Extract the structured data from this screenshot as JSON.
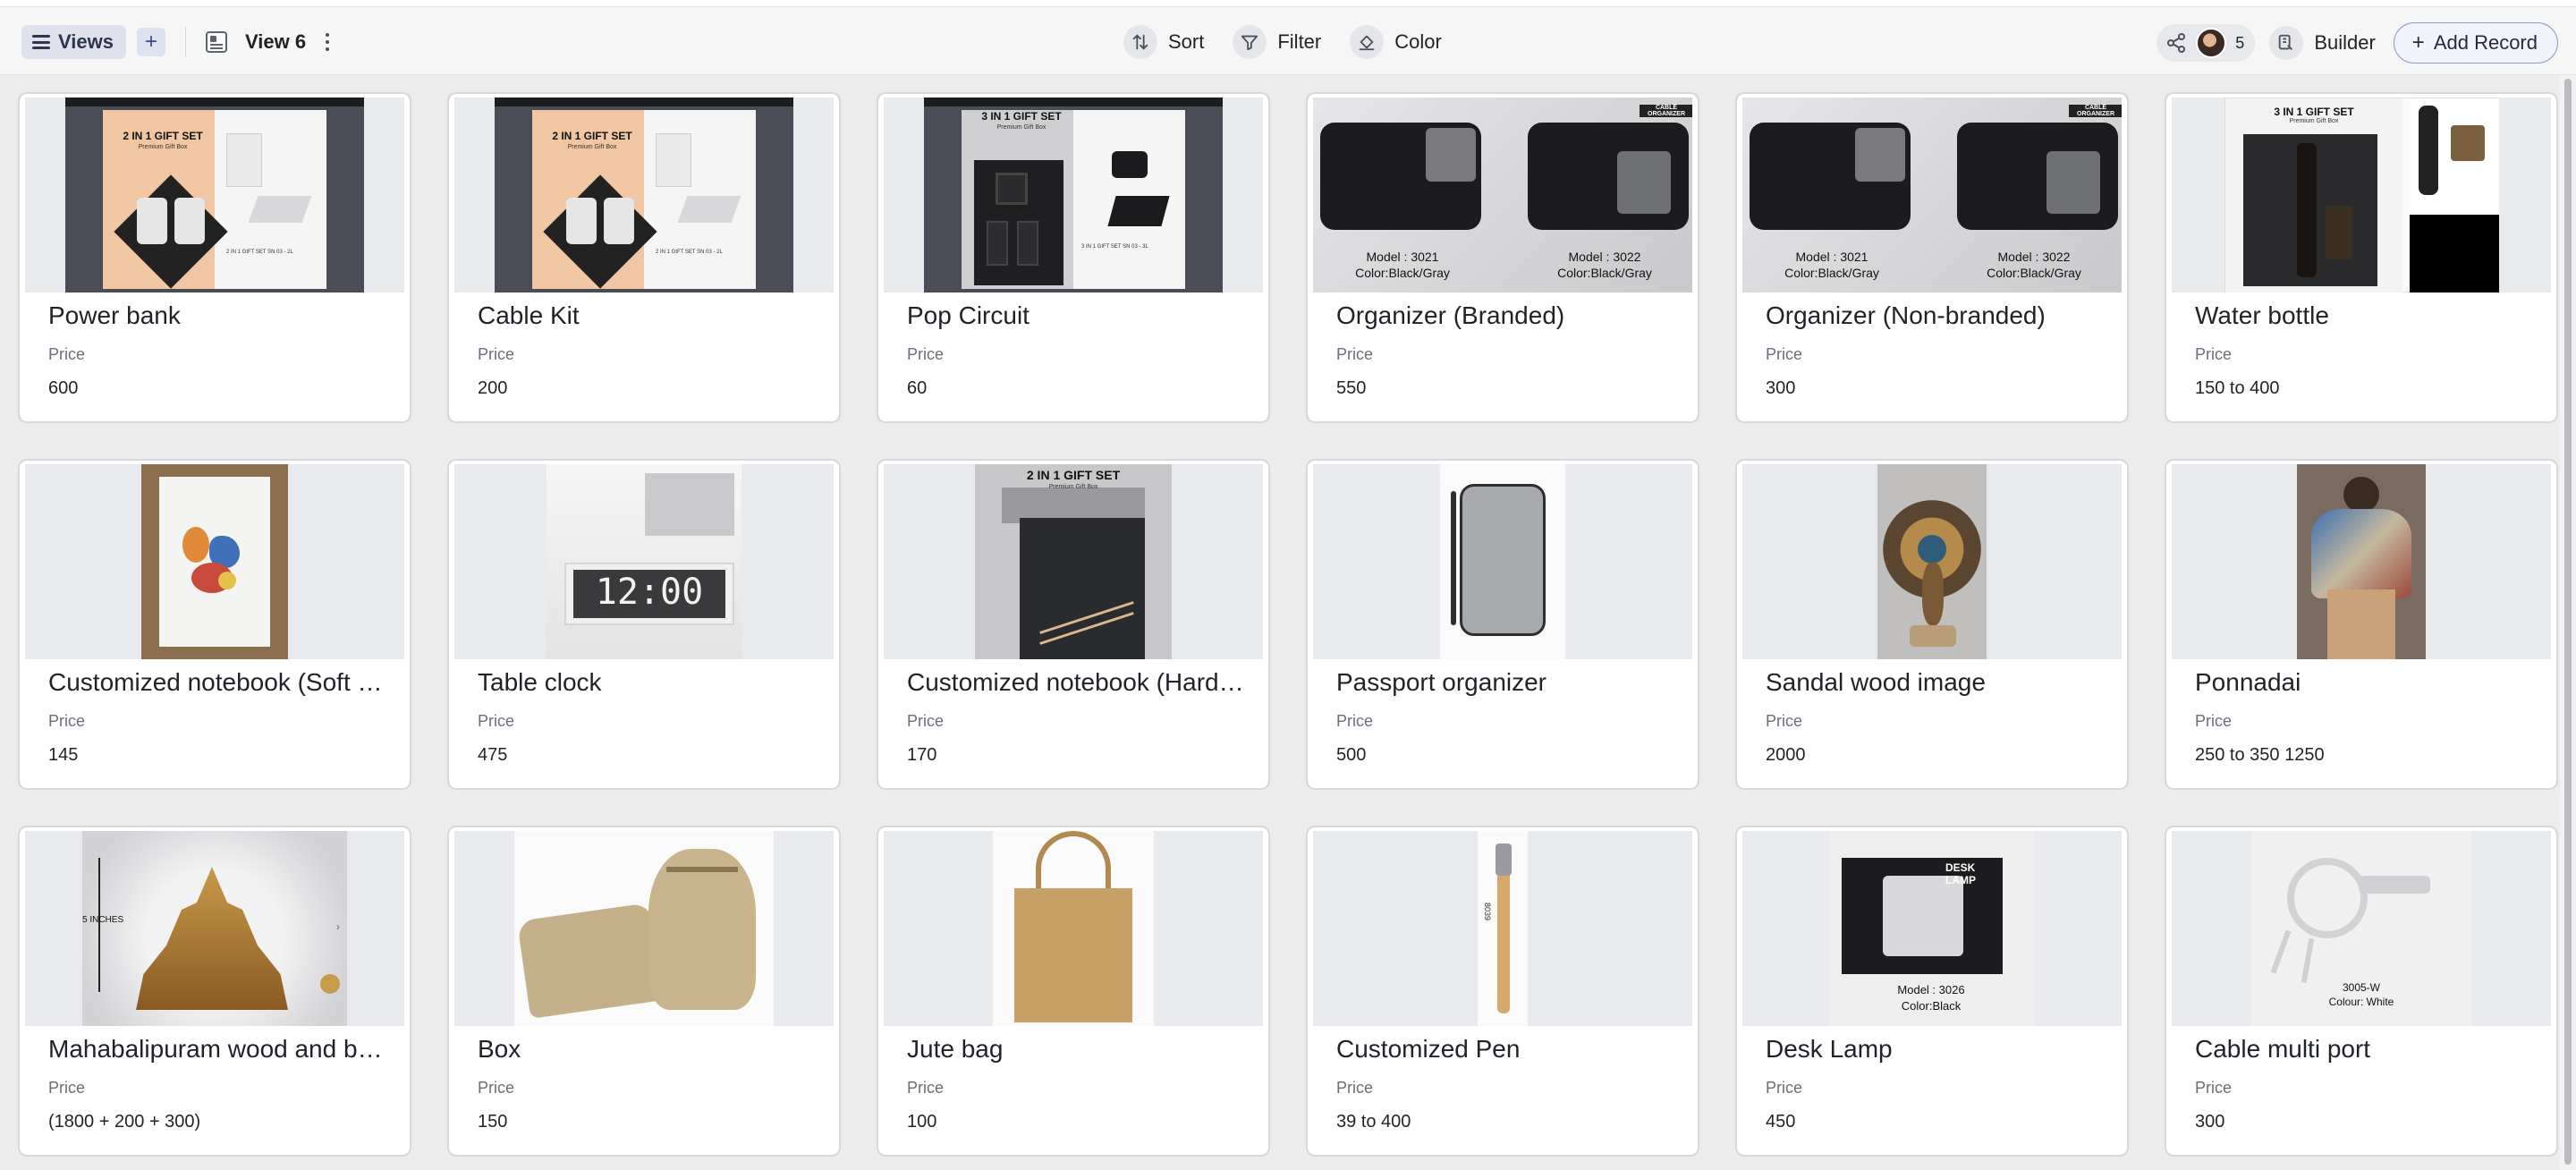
{
  "toolbar": {
    "views_label": "Views",
    "view_name": "View 6",
    "sort_label": "Sort",
    "filter_label": "Filter",
    "color_label": "Color",
    "collaborators_count": "5",
    "builder_label": "Builder",
    "add_record_label": "Add Record"
  },
  "records": [
    {
      "name": "Power bank",
      "price_label": "Price",
      "price": "600",
      "image_text": [
        "2 IN 1 GIFT SET",
        "Premium Gift Box",
        "2 IN 1 GIFT SET SN 03 - 2L"
      ]
    },
    {
      "name": "Cable Kit",
      "price_label": "Price",
      "price": "200",
      "image_text": [
        "2 IN 1 GIFT SET",
        "Premium Gift Box",
        "2 IN 1 GIFT SET SN 03 - 2L"
      ]
    },
    {
      "name": "Pop Circuit",
      "price_label": "Price",
      "price": "60",
      "image_text": [
        "3 IN 1 GIFT SET",
        "Premium Gift Box",
        "3 IN 1 GIFT SET SN 03 - 3L"
      ]
    },
    {
      "name": "Organizer (Branded)",
      "price_label": "Price",
      "price": "550",
      "image_text": [
        "CABLE ORGANIZER",
        "Model : 3021",
        "Color:Black/Gray",
        "Model : 3022",
        "Color:Black/Gray"
      ]
    },
    {
      "name": "Organizer (Non-branded)",
      "price_label": "Price",
      "price": "300",
      "image_text": [
        "CABLE ORGANIZER",
        "Model : 3021",
        "Color:Black/Gray",
        "Model : 3022",
        "Color:Black/Gray"
      ]
    },
    {
      "name": "Water bottle",
      "price_label": "Price",
      "price": "150 to 400",
      "image_text": [
        "3 IN 1 GIFT SET",
        "Premium Gift Box"
      ]
    },
    {
      "name": "Customized notebook (Soft cover)",
      "price_label": "Price",
      "price": "145",
      "image_text": []
    },
    {
      "name": "Table clock",
      "price_label": "Price",
      "price": "475",
      "image_text": [
        "12:00"
      ]
    },
    {
      "name": "Customized notebook (Hard cover)",
      "price_label": "Price",
      "price": "170",
      "image_text": [
        "2 IN 1 GIFT SET",
        "Premium Gift Box"
      ]
    },
    {
      "name": "Passport organizer",
      "price_label": "Price",
      "price": "500",
      "image_text": []
    },
    {
      "name": "Sandal wood image",
      "price_label": "Price",
      "price": "2000",
      "image_text": []
    },
    {
      "name": "Ponnadai",
      "price_label": "Price",
      "price": "250 to 350 1250",
      "image_text": []
    },
    {
      "name": "Mahabalipuram wood and brass",
      "price_label": "Price",
      "price": "(1800 + 200 + 300)",
      "image_text": [
        "5 INCHES"
      ]
    },
    {
      "name": "Box",
      "price_label": "Price",
      "price": "150",
      "image_text": []
    },
    {
      "name": "Jute bag",
      "price_label": "Price",
      "price": "100",
      "image_text": []
    },
    {
      "name": "Customized Pen",
      "price_label": "Price",
      "price": "39 to 400",
      "image_text": [
        "8039"
      ]
    },
    {
      "name": "Desk Lamp",
      "price_label": "Price",
      "price": "450",
      "image_text": [
        "DESK LAMP",
        "Model : 3026",
        "Color:Black"
      ]
    },
    {
      "name": "Cable multi port",
      "price_label": "Price",
      "price": "300",
      "image_text": [
        "3005-W",
        "Colour: White"
      ]
    }
  ],
  "colors": {
    "accent": "#3b4a8a",
    "card_border": "#d7d8dc",
    "background": "#ececed"
  }
}
